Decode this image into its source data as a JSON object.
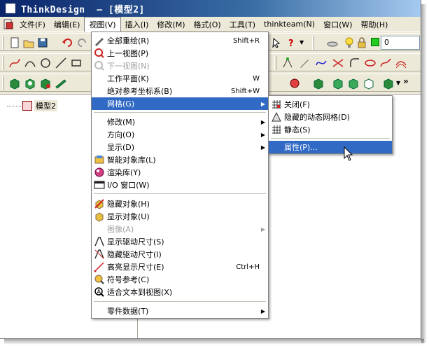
{
  "window": {
    "title": "ThinkDesign  – [模型2]"
  },
  "menubar": {
    "items": [
      {
        "label": "文件(F)"
      },
      {
        "label": "编辑(E)"
      },
      {
        "label": "视图(V)"
      },
      {
        "label": "插入(I)"
      },
      {
        "label": "修改(M)"
      },
      {
        "label": "格式(O)"
      },
      {
        "label": "工具(T)"
      },
      {
        "label": "thinkteam(N)"
      },
      {
        "label": "窗口(W)"
      },
      {
        "label": "帮助(H)"
      }
    ]
  },
  "toolbar": {
    "layer_value": "0"
  },
  "tree": {
    "root_label": "模型2"
  },
  "view_menu": {
    "items": [
      {
        "label": "全部重绘(R)",
        "shortcut": "Shift+R"
      },
      {
        "label": "上一视图(P)"
      },
      {
        "label": "下一视图(N)"
      },
      {
        "label": "工作平面(K)",
        "shortcut": "W"
      },
      {
        "label": "绝对参考坐标系(B)",
        "shortcut": "Shift+W"
      },
      {
        "label": "网格(G)"
      },
      {
        "label": "修改(M)"
      },
      {
        "label": "方向(O)"
      },
      {
        "label": "显示(D)"
      },
      {
        "label": "智能对象库(L)"
      },
      {
        "label": "渲染库(Y)"
      },
      {
        "label": "I/O 窗口(W)"
      },
      {
        "label": "隐藏对象(H)"
      },
      {
        "label": "显示对象(U)"
      },
      {
        "label": "图像(A)"
      },
      {
        "label": "显示驱动尺寸(S)"
      },
      {
        "label": "隐藏驱动尺寸(I)"
      },
      {
        "label": "高亮显示尺寸(E)",
        "shortcut": "Ctrl+H"
      },
      {
        "label": "符号参考(C)"
      },
      {
        "label": "适合文本到视图(X)"
      },
      {
        "label": "零件数据(T)"
      }
    ]
  },
  "grid_submenu": {
    "items": [
      {
        "label": "关闭(F)"
      },
      {
        "label": "隐藏的动态网格(D)"
      },
      {
        "label": "静态(S)"
      },
      {
        "label": "属性(P)..."
      }
    ]
  },
  "colors": {
    "highlight": "#316ac5",
    "title_start": "#0a246a",
    "title_end": "#a6caf0",
    "menu_bg": "#ece9d8"
  }
}
